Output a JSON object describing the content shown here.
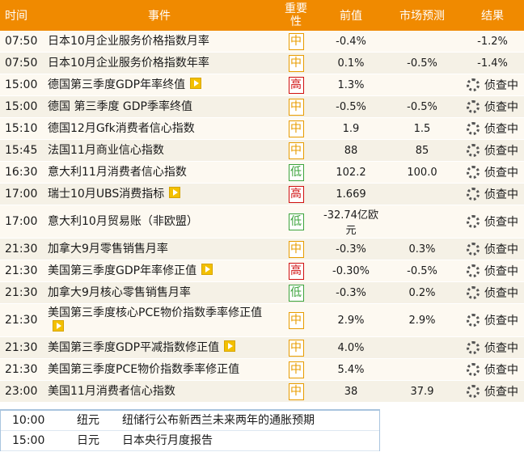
{
  "headers": {
    "time": "时间",
    "event": "事件",
    "importance": "重要性",
    "previous": "前值",
    "forecast": "市场预测",
    "result": "结果"
  },
  "pending_label": "侦查中",
  "rows": [
    {
      "time": "07:50",
      "event": "日本10月企业服务价格指数月率",
      "importance": "中",
      "level": "mid",
      "play": false,
      "previous": "-0.4%",
      "forecast": "",
      "result": "-1.2%"
    },
    {
      "time": "07:50",
      "event": "日本10月企业服务价格指数年率",
      "importance": "中",
      "level": "mid",
      "play": false,
      "previous": "0.1%",
      "forecast": "-0.5%",
      "result": "-1.4%"
    },
    {
      "time": "15:00",
      "event": "德国第三季度GDP年率终值",
      "importance": "高",
      "level": "high",
      "play": true,
      "previous": "1.3%",
      "forecast": "",
      "result": ""
    },
    {
      "time": "15:00",
      "event": "德国 第三季度 GDP季率终值",
      "importance": "中",
      "level": "mid",
      "play": false,
      "previous": "-0.5%",
      "forecast": "-0.5%",
      "result": ""
    },
    {
      "time": "15:10",
      "event": "德国12月Gfk消费者信心指数",
      "importance": "中",
      "level": "mid",
      "play": false,
      "previous": "1.9",
      "forecast": "1.5",
      "result": ""
    },
    {
      "time": "15:45",
      "event": "法国11月商业信心指数",
      "importance": "中",
      "level": "mid",
      "play": false,
      "previous": "88",
      "forecast": "85",
      "result": ""
    },
    {
      "time": "16:30",
      "event": "意大利11月消费者信心指数",
      "importance": "低",
      "level": "low",
      "play": false,
      "previous": "102.2",
      "forecast": "100.0",
      "result": ""
    },
    {
      "time": "17:00",
      "event": "瑞士10月UBS消费指标",
      "importance": "高",
      "level": "high",
      "play": true,
      "previous": "1.669",
      "forecast": "",
      "result": ""
    },
    {
      "time": "17:00",
      "event": "意大利10月贸易账（非欧盟）",
      "importance": "低",
      "level": "low",
      "play": false,
      "previous": "-32.74亿欧元",
      "forecast": "",
      "result": ""
    },
    {
      "time": "21:30",
      "event": "加拿大9月零售销售月率",
      "importance": "中",
      "level": "mid",
      "play": false,
      "previous": "-0.3%",
      "forecast": "0.3%",
      "result": ""
    },
    {
      "time": "21:30",
      "event": "美国第三季度GDP年率修正值",
      "importance": "高",
      "level": "high",
      "play": true,
      "previous": "-0.30%",
      "forecast": "-0.5%",
      "result": ""
    },
    {
      "time": "21:30",
      "event": "加拿大9月核心零售销售月率",
      "importance": "低",
      "level": "low",
      "play": false,
      "previous": "-0.3%",
      "forecast": "0.2%",
      "result": ""
    },
    {
      "time": "21:30",
      "event": "美国第三季度核心PCE物价指数季率修正值",
      "importance": "中",
      "level": "mid",
      "play": true,
      "previous": "2.9%",
      "forecast": "2.9%",
      "result": ""
    },
    {
      "time": "21:30",
      "event": "美国第三季度GDP平减指数修正值",
      "importance": "中",
      "level": "mid",
      "play": true,
      "previous": "4.0%",
      "forecast": "",
      "result": ""
    },
    {
      "time": "21:30",
      "event": "美国第三季度PCE物价指数季率修正值",
      "importance": "中",
      "level": "mid",
      "play": false,
      "previous": "5.4%",
      "forecast": "",
      "result": ""
    },
    {
      "time": "23:00",
      "event": "美国11月消费者信心指数",
      "importance": "中",
      "level": "mid",
      "play": false,
      "previous": "38",
      "forecast": "37.9",
      "result": ""
    }
  ],
  "notes": [
    {
      "time": "10:00",
      "currency": "纽元",
      "text": "纽储行公布新西兰未来两年的通胀预期"
    },
    {
      "time": "15:00",
      "currency": "日元",
      "text": "日本央行月度报告"
    }
  ]
}
